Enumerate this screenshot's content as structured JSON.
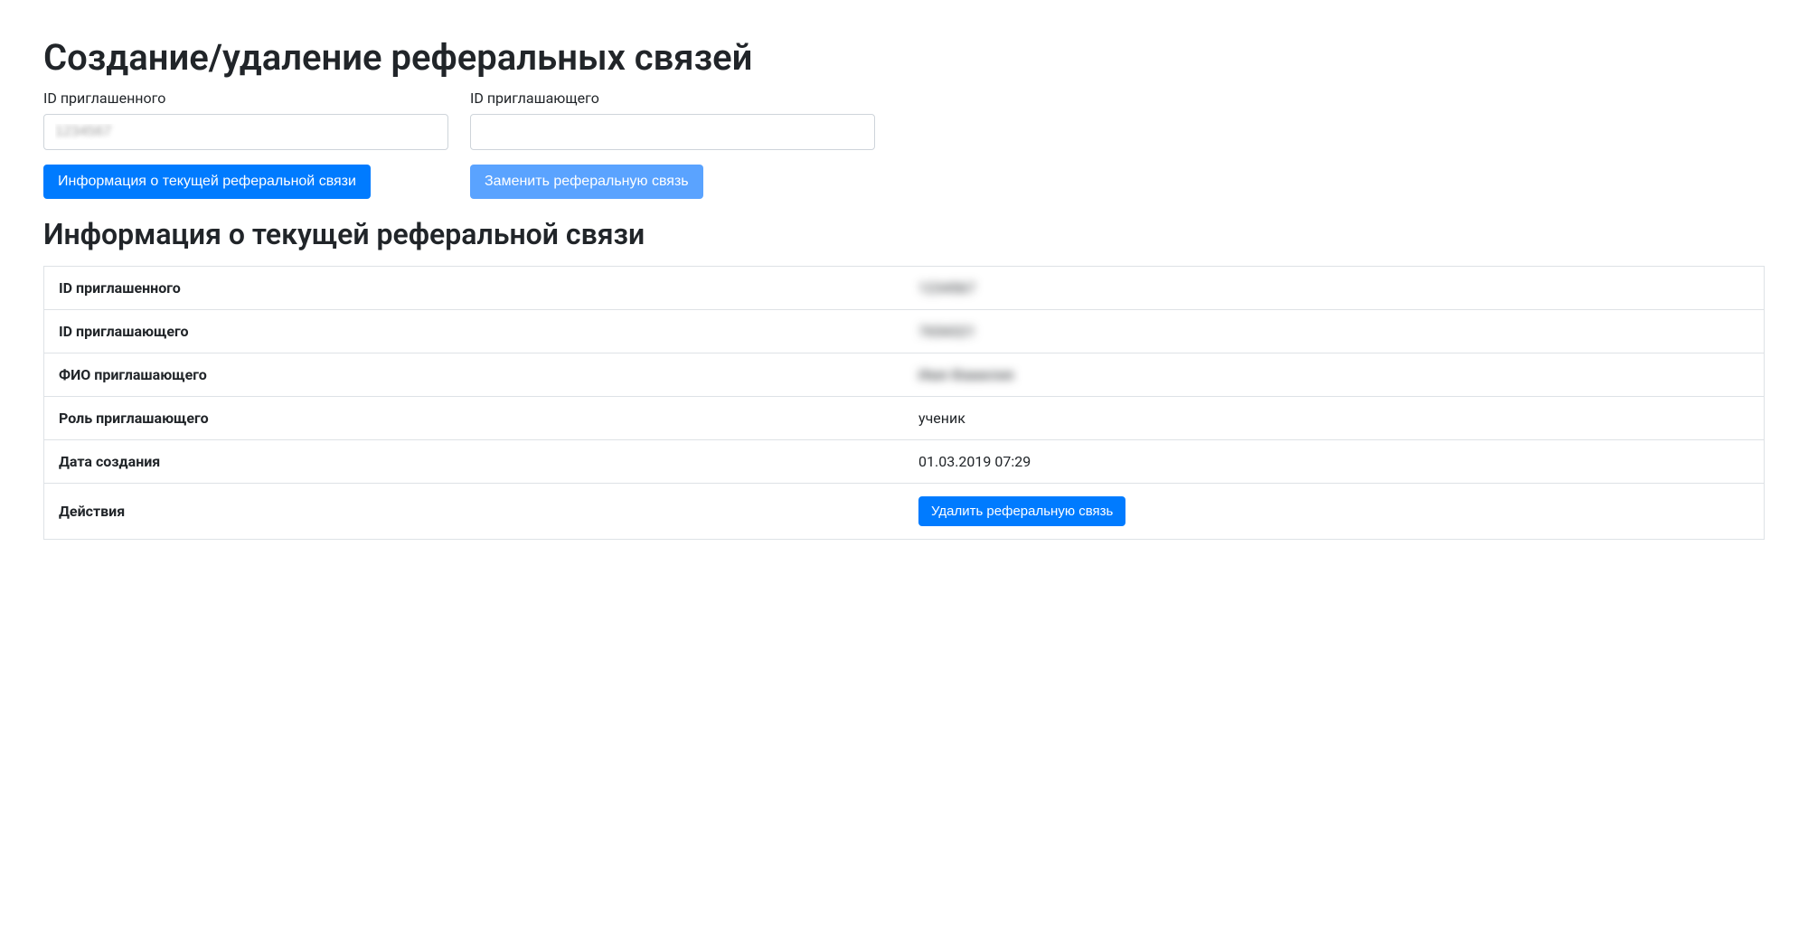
{
  "page": {
    "title": "Создание/удаление реферальных связей",
    "subtitle": "Информация о текущей реферальной связи"
  },
  "form": {
    "invited_id": {
      "label": "ID приглашенного",
      "value": "1234567"
    },
    "inviter_id": {
      "label": "ID приглашающего",
      "value": ""
    },
    "info_button": "Информация о текущей реферальной связи",
    "replace_button": "Заменить реферальную связь"
  },
  "info_table": {
    "rows": {
      "invited_id": {
        "label": "ID приглашенного",
        "value": "1234567",
        "blurred": true
      },
      "inviter_id": {
        "label": "ID приглашающего",
        "value": "7654321",
        "blurred": true
      },
      "inviter_name": {
        "label": "ФИО приглашающего",
        "value": "Имя Фамилия",
        "blurred": true
      },
      "inviter_role": {
        "label": "Роль приглашающего",
        "value": "ученик",
        "blurred": false
      },
      "created_at": {
        "label": "Дата создания",
        "value": "01.03.2019 07:29",
        "blurred": false
      },
      "actions": {
        "label": "Действия",
        "delete_button": "Удалить реферальную связь"
      }
    }
  }
}
